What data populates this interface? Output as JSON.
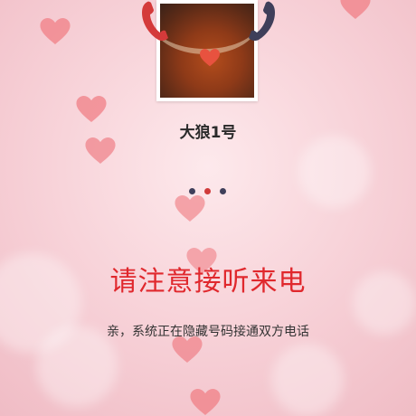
{
  "caller": {
    "name": "大狼1号"
  },
  "call": {
    "headline": "请注意接听来电",
    "subtext": "亲，系统正在隐藏号码接通双方电话"
  },
  "colors": {
    "accent": "#e0282d",
    "phone_left": "#d43a3a",
    "phone_right": "#3f3f5a",
    "heart": "#f07f86"
  },
  "icons": {
    "phone_left": "phone-handset-icon",
    "phone_right": "phone-handset-icon",
    "decor": "heart-icon"
  }
}
